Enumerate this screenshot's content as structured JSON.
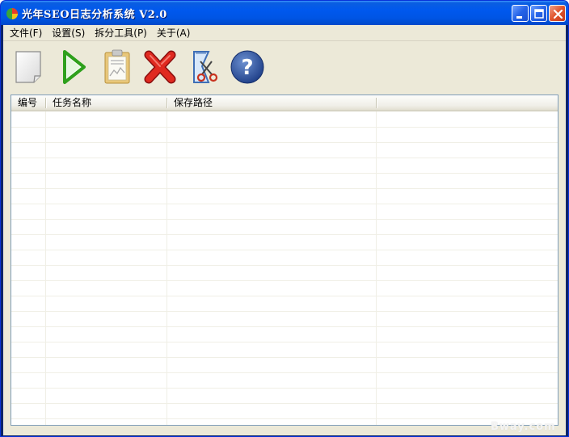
{
  "window": {
    "title": "光年SEO日志分析系统 V2.0",
    "icon": "app-pie-icon"
  },
  "menu": [
    {
      "label": "文件(F)"
    },
    {
      "label": "设置(S)"
    },
    {
      "label": "拆分工具(P)"
    },
    {
      "label": "关于(A)"
    }
  ],
  "toolbar": [
    {
      "icon": "new-document-icon"
    },
    {
      "icon": "play-icon"
    },
    {
      "icon": "clipboard-report-icon"
    },
    {
      "icon": "delete-x-icon"
    },
    {
      "icon": "split-scissors-icon"
    },
    {
      "icon": "help-icon"
    }
  ],
  "list": {
    "columns": [
      "编号",
      "任务名称",
      "保存路径",
      ""
    ],
    "rows": []
  },
  "watermark": "Bway.com",
  "colors": {
    "titlebar": "#0055e5",
    "client": "#ece9d8",
    "list_border": "#7f9db9"
  }
}
